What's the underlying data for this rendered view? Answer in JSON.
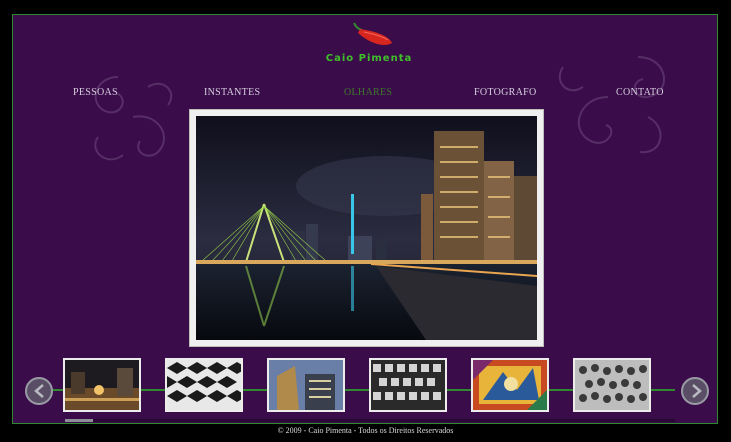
{
  "brand": {
    "name": "Caio Pimenta",
    "logo_icon": "chili-pepper-icon",
    "colors": {
      "pepper": "#d7261e",
      "stem": "#2f8a2f",
      "text": "#3fbf2a"
    }
  },
  "nav": {
    "items": [
      {
        "label": "PESSOAS"
      },
      {
        "label": "INSTANTES"
      },
      {
        "label": "OLHARES"
      },
      {
        "label": "FOTOGRAFO"
      },
      {
        "label": "CONTATO"
      }
    ],
    "active": "OLHARES",
    "colors": {
      "default": "#d8cfe0",
      "active": "#3c7a2a"
    }
  },
  "gallery": {
    "main_photo": "night-city-bridge-photo",
    "thumbnails": [
      {
        "name": "plaza-night-thumb"
      },
      {
        "name": "bw-pattern-thumb"
      },
      {
        "name": "tower-dusk-thumb"
      },
      {
        "name": "bw-rows-thumb"
      },
      {
        "name": "painting-thumb"
      },
      {
        "name": "bw-crowd-thumb"
      }
    ],
    "prev_icon": "arrow-left-icon",
    "next_icon": "arrow-right-icon",
    "scroll_position": 0.05
  },
  "footer": {
    "text": "© 2009 - Caio Pimenta - Todos os Direitos Reservados"
  },
  "theme": {
    "background": "#3a0d4a",
    "border": "#2f8a2f"
  }
}
